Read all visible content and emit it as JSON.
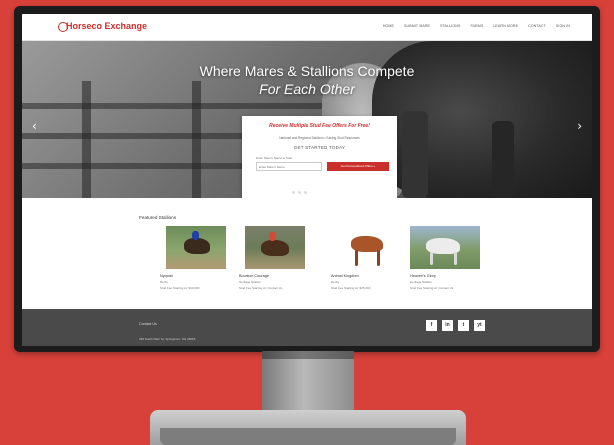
{
  "site": {
    "logo_text": "Horseco Exchange",
    "brand_color": "#c9302c"
  },
  "nav": {
    "items": [
      "HOME",
      "SUBMIT MARE",
      "STALLIONS",
      "FARMS",
      "LEARN MORE",
      "CONTACT",
      "SIGN IN"
    ]
  },
  "hero": {
    "title_line1": "Where Mares & Stallions Compete",
    "title_line2": "For Each Other",
    "arrow_left": "‹",
    "arrow_right": "›"
  },
  "offer": {
    "title": "Receive Multiple Stud Fee Offers For Free!",
    "subtitle": "National and Regional Stallions • Saving Stud Resources",
    "cta": "GET STARTED TODAY",
    "input_label": "Enter Mare's Name to Start",
    "input_placeholder": "Enter Mare's Name",
    "button_label": "Get Personalized Offers »"
  },
  "featured": {
    "title": "Featured Stallions",
    "stallions": [
      {
        "name": "Nyquist",
        "breed": "Derby",
        "fee": "Stud Fee Starting At: $40,000"
      },
      {
        "name": "Bourbon Courage",
        "breed": "Heritage Stallion",
        "fee": "Stud Fee Starting At: Contact Us"
      },
      {
        "name": "Animal Kingdom",
        "breed": "Derby",
        "fee": "Stud Fee Starting At: $35,000"
      },
      {
        "name": "Heaven's Glory",
        "breed": "Heritage Stallion",
        "fee": "Stud Fee Starting At: Contact Us"
      }
    ]
  },
  "footer": {
    "contact_label": "Contact Us",
    "address": "250 South Main St, Springboro, OH 45066",
    "social_icons": [
      "f",
      "in",
      "t",
      "yt"
    ]
  }
}
